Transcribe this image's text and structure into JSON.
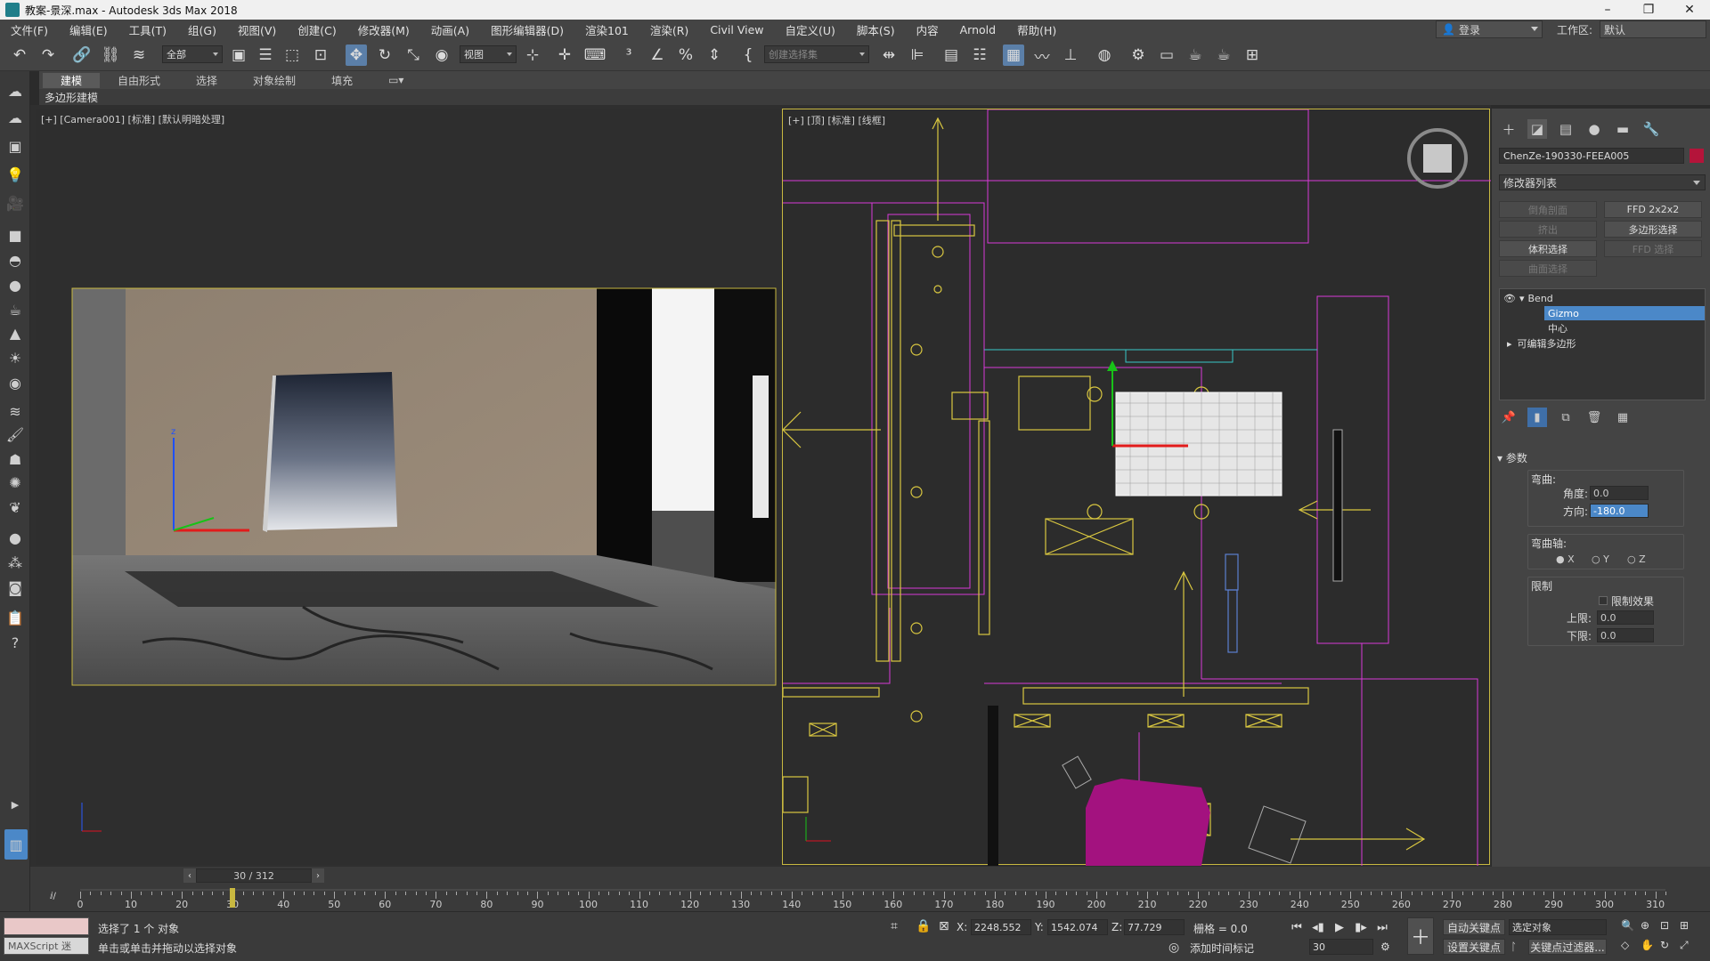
{
  "window": {
    "title": "教案-景深.max - Autodesk 3ds Max 2018",
    "min_icon": "minimize-icon",
    "max_icon": "restore-icon",
    "close_icon": "close-icon"
  },
  "menu": {
    "items": [
      "文件(F)",
      "编辑(E)",
      "工具(T)",
      "组(G)",
      "视图(V)",
      "创建(C)",
      "修改器(M)",
      "动画(A)",
      "图形编辑器(D)",
      "渲染101",
      "渲染(R)",
      "Civil View",
      "自定义(U)",
      "脚本(S)",
      "内容",
      "Arnold",
      "帮助(H)"
    ],
    "login": "登录",
    "workspace_label": "工作区:",
    "workspace_value": "默认"
  },
  "toolbar": {
    "selection_filter": "全部",
    "ref_coord": "视图",
    "named_selection_placeholder": "创建选择集"
  },
  "ribbon": {
    "tabs": [
      "建模",
      "自由形式",
      "选择",
      "对象绘制",
      "填充"
    ],
    "active_tab": "建模",
    "sub_label": "多边形建模"
  },
  "viewports": {
    "left_label": "[+] [Camera001] [标准] [默认明暗处理]",
    "right_label": "[+] [顶] [标准] [线框]"
  },
  "command_panel": {
    "object_name": "ChenZe-190330-FEEA005",
    "object_color": "#b4143a",
    "modifier_list": "修改器列表",
    "modifier_buttons": [
      "倒角剖面",
      "FFD 2x2x2",
      "挤出",
      "多边形选择",
      "体积选择",
      "FFD 选择",
      "曲面选择"
    ],
    "stack": [
      "Bend",
      "Gizmo",
      "中心",
      "可编辑多边形"
    ],
    "stack_selected": "Gizmo",
    "rollout_title": "参数",
    "bend_group": "弯曲:",
    "angle_label": "角度:",
    "angle_value": "0.0",
    "direction_label": "方向:",
    "direction_value": "-180.0",
    "axis_group": "弯曲轴:",
    "axes": [
      "X",
      "Y",
      "Z"
    ],
    "selected_axis": "X",
    "limits_group": "限制",
    "limit_effect": "限制效果",
    "upper_label": "上限:",
    "upper_value": "0.0",
    "lower_label": "下限:",
    "lower_value": "0.0"
  },
  "timeline": {
    "frame_display": "30 / 312",
    "current_frame": 30,
    "total_frames": 312,
    "ticks": [
      "0",
      "10",
      "20",
      "30",
      "40",
      "50",
      "60",
      "70",
      "80",
      "90",
      "100",
      "110",
      "120",
      "130",
      "140",
      "150",
      "160",
      "170",
      "180",
      "190",
      "200",
      "210",
      "220",
      "230",
      "240",
      "250",
      "260",
      "270",
      "280",
      "290",
      "300",
      "310"
    ]
  },
  "status": {
    "maxscript": "MAXScript 迷",
    "selected": "选择了 1 个 对象",
    "prompt": "单击或单击并拖动以选择对象",
    "x_label": "X:",
    "x_value": "2248.552",
    "y_label": "Y:",
    "y_value": "1542.074",
    "z_label": "Z:",
    "z_value": "77.729",
    "grid": "栅格 = 0.0",
    "add_time_tag": "添加时间标记",
    "auto_key": "自动关键点",
    "set_key": "设置关键点",
    "key_target": "选定对象",
    "key_filters": "关键点过滤器...",
    "frame_field": "30"
  }
}
